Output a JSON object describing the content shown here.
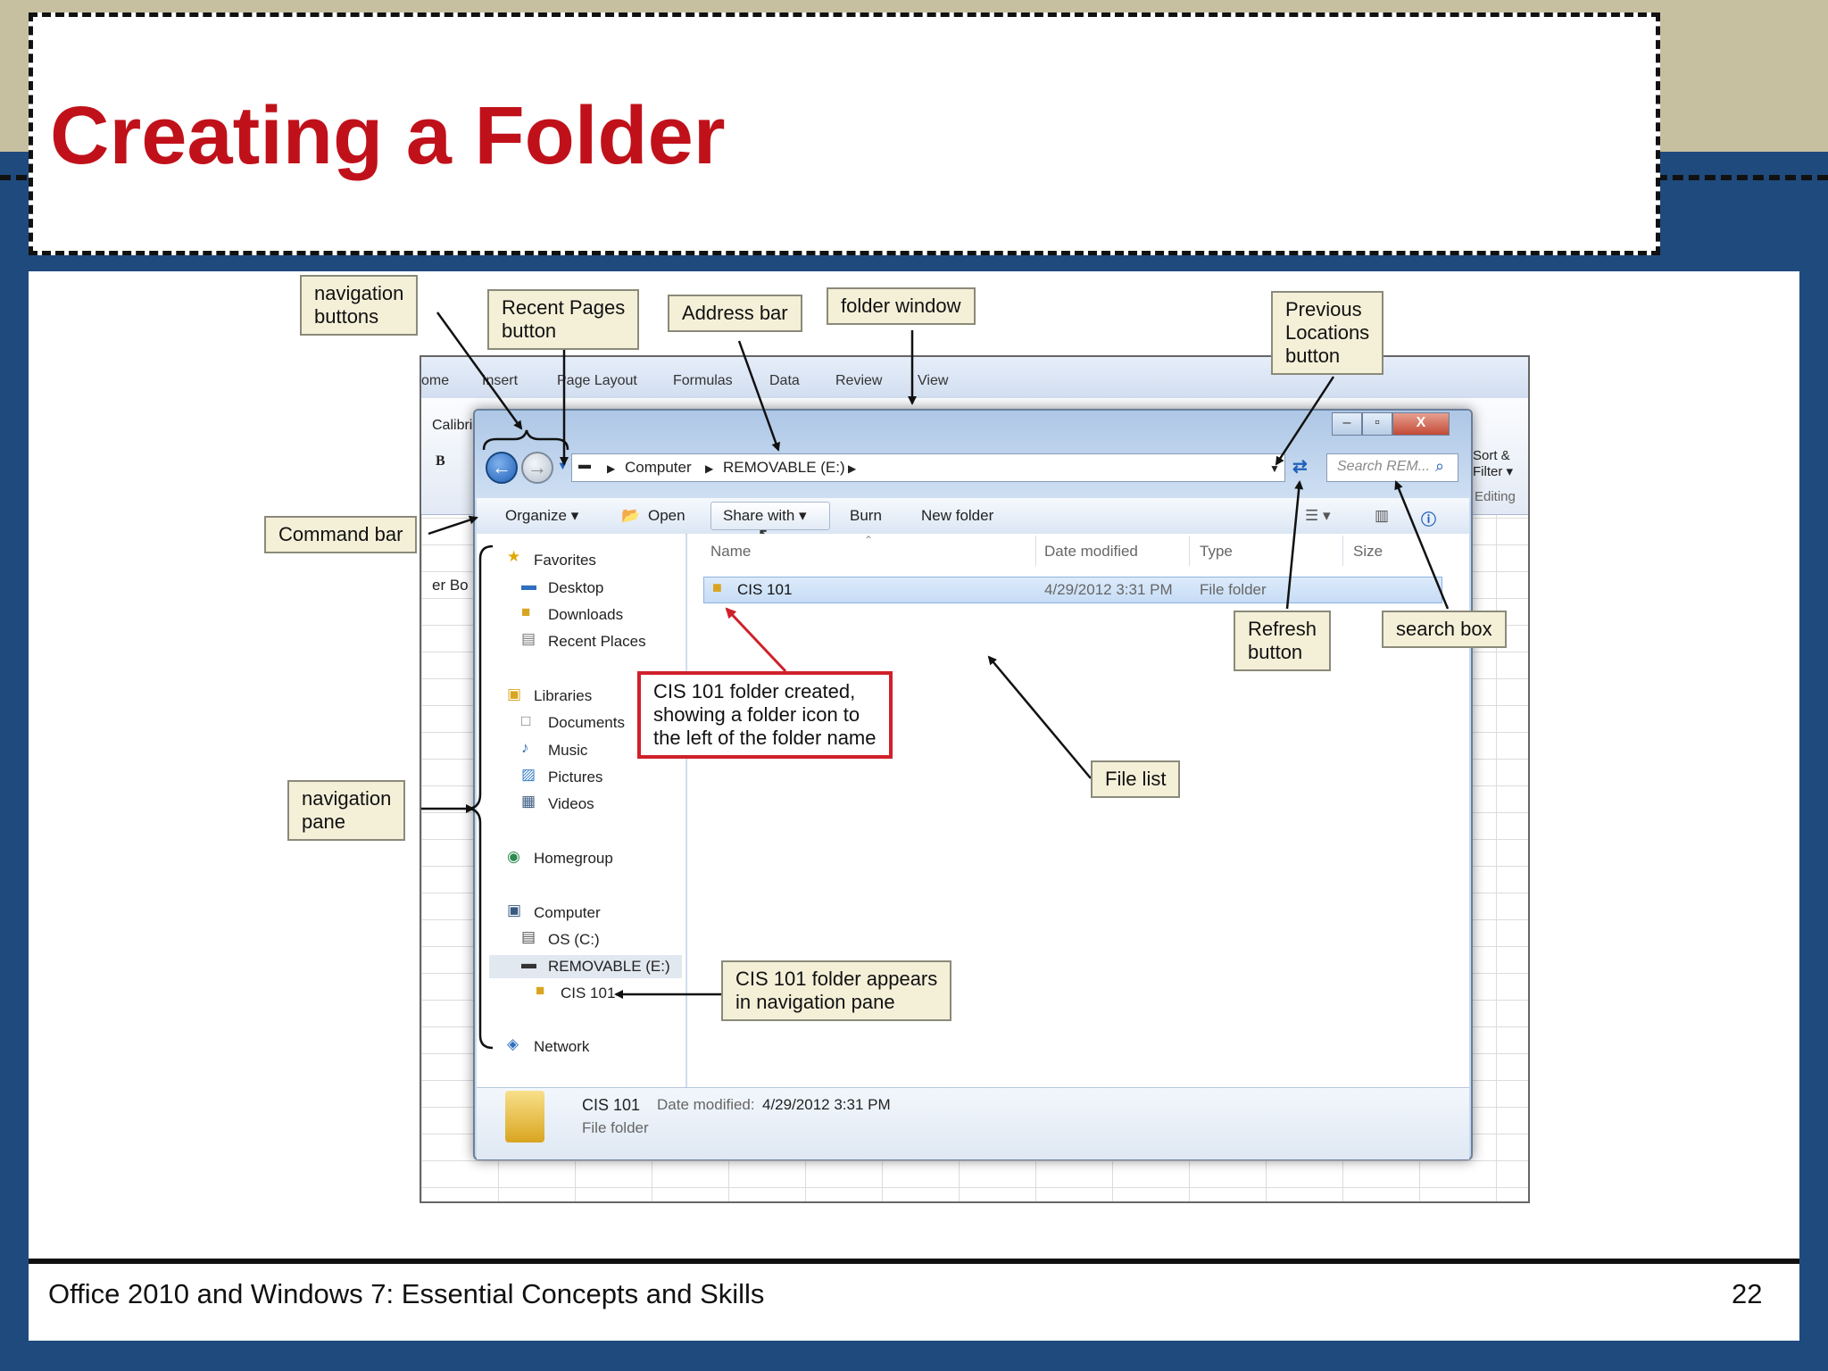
{
  "slide": {
    "title": "Creating a Folder",
    "footer": "Office 2010 and Windows 7: Essential Concepts and Skills",
    "page_number": "22"
  },
  "excel_background": {
    "tabs": [
      "ome",
      "Insert",
      "Page Layout",
      "Formulas",
      "Data",
      "Review",
      "View"
    ],
    "font_box": "Calibri",
    "bold": "B",
    "sort_filter": "Sort & Filter ▾",
    "editing": "Editing",
    "cell_text": "er Bo"
  },
  "explorer": {
    "window_buttons": {
      "minimize": "–",
      "maximize": "▫",
      "close": "X"
    },
    "back_icon": "back-arrow-icon",
    "forward_icon": "forward-arrow-icon",
    "address_path": [
      "Computer",
      "REMOVABLE (E:)"
    ],
    "search_placeholder": "Search REM...",
    "command_bar": {
      "organize": "Organize ▾",
      "open": "Open",
      "share_with": "Share with ▾",
      "burn": "Burn",
      "new_folder": "New folder"
    },
    "nav_pane": {
      "favorites": "Favorites",
      "desktop": "Desktop",
      "downloads": "Downloads",
      "recent_places": "Recent Places",
      "libraries": "Libraries",
      "documents": "Documents",
      "music": "Music",
      "pictures": "Pictures",
      "videos": "Videos",
      "homegroup": "Homegroup",
      "computer": "Computer",
      "os_c": "OS (C:)",
      "removable_e": "REMOVABLE (E:)",
      "cis101": "CIS 101",
      "network": "Network"
    },
    "columns": {
      "name": "Name",
      "date_modified": "Date modified",
      "type": "Type",
      "size": "Size"
    },
    "rows": [
      {
        "name": "CIS 101",
        "date_modified": "4/29/2012 3:31 PM",
        "type": "File folder",
        "size": ""
      }
    ],
    "details_pane": {
      "name": "CIS 101",
      "date_label": "Date modified:",
      "date_value": "4/29/2012 3:31 PM",
      "type": "File folder"
    }
  },
  "callouts": {
    "navigation_buttons": "navigation\nbuttons",
    "recent_pages": "Recent Pages\nbutton",
    "address_bar": "Address bar",
    "folder_window": "folder window",
    "previous_locations": "Previous\nLocations\nbutton",
    "command_bar": "Command bar",
    "refresh": "Refresh\nbutton",
    "search_box": "search box",
    "file_list": "File list",
    "navigation_pane": "navigation\npane",
    "red_note": "CIS 101 folder created,\nshowing a folder icon to\nthe left of the folder name",
    "nav_pane_note": "CIS 101 folder appears\nin navigation pane"
  },
  "colors": {
    "title_red": "#c0111a",
    "slide_blue": "#1f4a7e",
    "tan": "#c6c0a0",
    "callout_fill": "#f4f0d8",
    "red_callout_border": "#d0202a"
  }
}
